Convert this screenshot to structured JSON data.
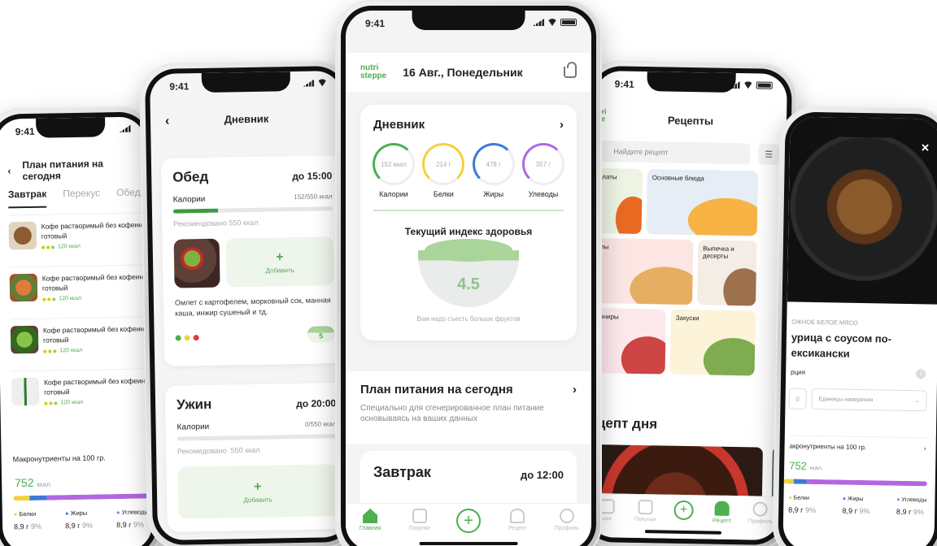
{
  "status": {
    "time": "9:41"
  },
  "colors": {
    "accent": "#4caf50",
    "protein": "#f4d03f",
    "fat": "#3b7bd8",
    "carbs": "#b267e0"
  },
  "p1": {
    "title": "План питания на сегодня",
    "tabs": [
      "Завтрак",
      "Перекус",
      "Обед"
    ],
    "items": [
      {
        "name": "Кофе растворимый без кофеина готовый",
        "kcal": "120 ккал"
      },
      {
        "name": "Кофе растворимый без кофеина готовый",
        "kcal": "120 ккал"
      },
      {
        "name": "Кофе растворимый без кофеина готовый",
        "kcal": "120 ккал"
      },
      {
        "name": "Кофе растворимый без кофеина готовый",
        "kcal": "120 ккал"
      }
    ],
    "macro_title": "Макронутриенты на 100 гр.",
    "kcal_value": "752",
    "kcal_unit": "ккал.",
    "macros": [
      {
        "label": "Белки",
        "value": "8,9 г",
        "pct": "9%"
      },
      {
        "label": "Жиры",
        "value": "8,9 г",
        "pct": "9%"
      },
      {
        "label": "Углеводы",
        "value": "8,9 г",
        "pct": "9%"
      }
    ]
  },
  "p2": {
    "title": "Дневник",
    "lunch": {
      "name": "Обед",
      "time": "до 15:00",
      "cal_label": "Калории",
      "cal_value": "152/550 ккал",
      "progress": 0.28,
      "rec": "Рекомендовано 550 ккал",
      "add": "Добавить",
      "desc": "Омлет с картофелем, морковный сок, манная каша, инжир сушеный и тд.",
      "badge": "5"
    },
    "dinner": {
      "name": "Ужин",
      "time": "до 20:00",
      "cal_label": "Калории",
      "cal_value": "0/550 ккал",
      "progress": 0,
      "rec": "Рекомедовано",
      "rec_val": "550 ккал",
      "add": "Добавить"
    }
  },
  "p3": {
    "logo_line1": "nutri",
    "logo_line2": "steppe",
    "date": "16 Авг., Понедельник",
    "diary_title": "Дневник",
    "gauges": [
      {
        "label": "Калории",
        "value": "152 ккал"
      },
      {
        "label": "Белки",
        "value": "214 г"
      },
      {
        "label": "Жиры",
        "value": "478 г"
      },
      {
        "label": "Улеводы",
        "value": "357 г"
      }
    ],
    "health_title": "Текущий индекс здоровья",
    "health_value": "4.5",
    "health_note": "Вам надо съесть больше фруктов",
    "plan_title": "План питания на сегодня",
    "plan_sub": "Специально для сгенерированное план питание основываясь на ваших данных",
    "breakfast_name": "Завтрак",
    "breakfast_time": "до 12:00",
    "tabs": [
      "Главная",
      "Покупки",
      "",
      "Рецепт",
      "Профиль"
    ]
  },
  "p4": {
    "logo": "utri\nste",
    "title": "Рецепты",
    "search_placeholder": "Найдите рецепт",
    "categories": [
      "алаты",
      "Основные блюда",
      "упы",
      "Выпечка и десерты",
      "арниры",
      "Закуски"
    ],
    "recipe_of_day": "ецепт дня",
    "tabs": [
      "ная",
      "Покупки",
      "",
      "Рецепт",
      "Профиль"
    ]
  },
  "p5": {
    "tag": "ОЖНОЕ БЕЛОЕ МЯСО",
    "title": "урица с соусом по-ексикански",
    "portion": "рция",
    "qty": "0",
    "unit_placeholder": "Единицы измерения",
    "macro_title": "акронутриенты на 100 гр.",
    "kcal_value": "752",
    "kcal_unit": "ккал.",
    "macros": [
      {
        "label": "Белки",
        "value": "8,9 г",
        "pct": "9%"
      },
      {
        "label": "Жиры",
        "value": "8,9 г",
        "pct": "9%"
      },
      {
        "label": "Углеводы",
        "value": "8,9 г",
        "pct": "9%"
      }
    ]
  }
}
